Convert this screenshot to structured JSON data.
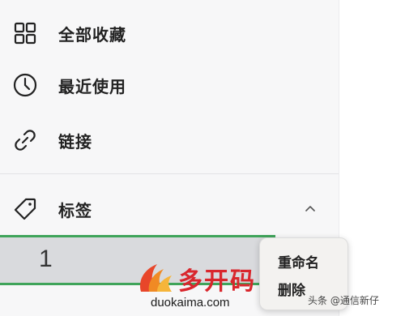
{
  "nav": {
    "items": [
      {
        "label": "全部收藏",
        "icon": "grid-icon"
      },
      {
        "label": "最近使用",
        "icon": "clock-icon"
      },
      {
        "label": "链接",
        "icon": "link-icon"
      }
    ]
  },
  "tags": {
    "header": {
      "label": "标签",
      "icon": "tag-icon",
      "toggle_icon": "chevron-up-icon"
    },
    "items": [
      {
        "name": "1",
        "selected": true
      }
    ]
  },
  "context_menu": {
    "items": [
      "重命名",
      "删除"
    ]
  },
  "watermark": {
    "title": "多开码",
    "domain": "duokaima.com",
    "credit": "头条 @通信新仔"
  },
  "colors": {
    "accent": "#3fa45a",
    "watermark_red": "#d9262c",
    "sidebar_bg": "#f7f7f8"
  }
}
